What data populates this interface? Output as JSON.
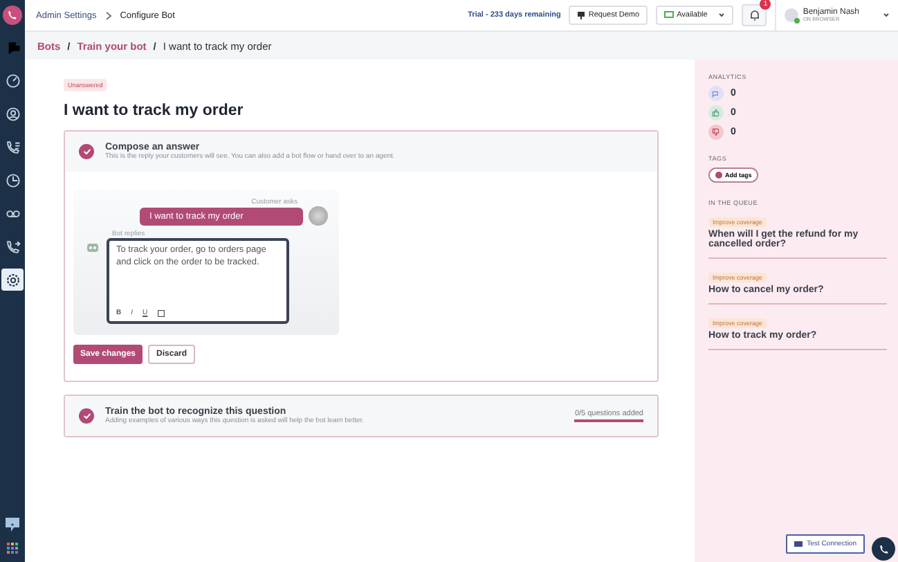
{
  "sidebar": {
    "items": [
      {
        "kind": "flag",
        "selected": false
      },
      {
        "kind": "gauge",
        "selected": false
      },
      {
        "kind": "contact",
        "selected": false
      },
      {
        "kind": "call-list",
        "selected": false
      },
      {
        "kind": "clock",
        "selected": false
      },
      {
        "kind": "voicemail",
        "selected": false
      },
      {
        "kind": "call-forward",
        "selected": false
      },
      {
        "kind": "settings",
        "selected": true
      }
    ]
  },
  "header": {
    "path": [
      "Admin Settings",
      "Configure Bot"
    ],
    "trial": "Trial - 233 days remaining",
    "request_demo": "Request Demo",
    "status": "Available",
    "notification_count": "1",
    "user": {
      "name": "Benjamin Nash",
      "subtitle": "ON BROWSER",
      "online": true
    }
  },
  "breadcrumb": [
    "Bots",
    "Train your bot",
    "I want to track my order"
  ],
  "breadcrumb_separator": "/",
  "status_tag": "Unanswered",
  "title": "I want to track my order",
  "steps": [
    {
      "title": "Compose an answer",
      "description": "This is the reply your customers will see. You can also add a bot flow or hand over to an agent.",
      "done": true,
      "expanded": true
    },
    {
      "title": "Train the bot to recognize this question",
      "description": "Adding examples of various ways this question is asked will help the bot learn better.",
      "done": true,
      "expanded": false,
      "progress": "0/5 questions added"
    }
  ],
  "compose": {
    "customer_label": "Customer asks",
    "customer_message": "I want to track my order",
    "bot_label": "Bot replies",
    "bot_reply": "To track your order, go to orders page and click on the order to be tracked.",
    "format_buttons": [
      "B",
      "I",
      "U"
    ],
    "save": "Save changes",
    "discard": "Discard"
  },
  "analytics": {
    "heading": "ANALYTICS",
    "items": [
      {
        "kind": "views",
        "value": "0",
        "color": "#dfe2f6"
      },
      {
        "kind": "thumbs-up",
        "value": "0",
        "color": "#d6ece0"
      },
      {
        "kind": "thumbs-down",
        "value": "0",
        "color": "#f3c9ce"
      }
    ]
  },
  "tags": {
    "heading": "TAGS",
    "add": "Add tags"
  },
  "queue": {
    "heading": "IN THE QUEUE",
    "items": [
      {
        "tag": "Improve coverage",
        "question": "When will I get the refund for my cancelled order?"
      },
      {
        "tag": "Improve coverage",
        "question": "How to cancel my order?"
      },
      {
        "tag": "Improve coverage",
        "question": "How to track my order?"
      }
    ]
  },
  "test_connection": "Test Connection"
}
